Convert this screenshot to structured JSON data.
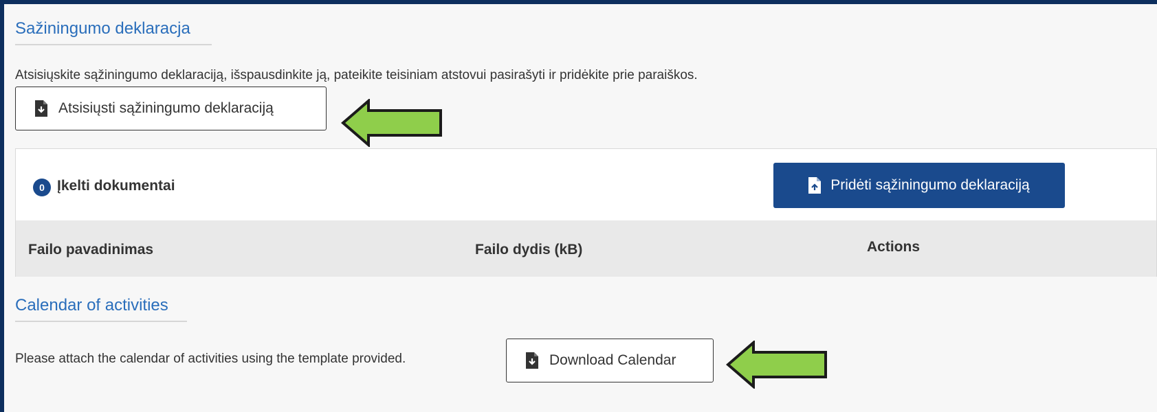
{
  "declaration": {
    "title": "Sažiningumo deklaracja",
    "description": "Atsisiųskite sąžiningumo deklaraciją, išspausdinkite ją, pateikite teisiniam atstovui pasirašyti ir pridėkite prie paraiškos.",
    "download_label": "Atsisiųsti sąžiningumo deklaraciją"
  },
  "documents": {
    "count": "0",
    "label": "Įkelti dokumentai",
    "add_label": "Pridėti sąžiningumo deklaraciją",
    "columns": [
      "Failo pavadinimas",
      "Failo dydis (kB)",
      "Actions"
    ]
  },
  "calendar": {
    "title": "Calendar of activities",
    "description": "Please attach the calendar of activities using the template provided.",
    "download_label": "Download Calendar"
  },
  "colors": {
    "frame": "#0d2f5e",
    "primary": "#1a4a8d",
    "link": "#2a6ebb",
    "arrow": "#8fce4b"
  },
  "icons": [
    "file-download-icon",
    "file-upload-icon",
    "arrow-left-icon"
  ]
}
